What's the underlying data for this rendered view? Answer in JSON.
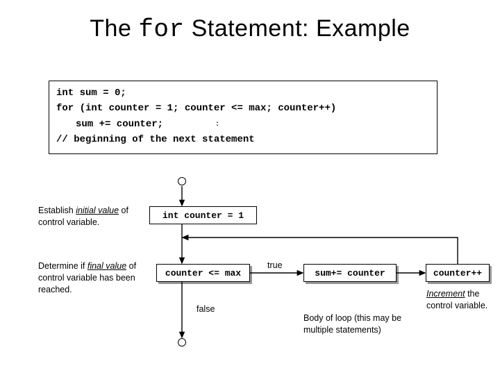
{
  "title": {
    "pre": "The ",
    "kw": "for",
    "post": " Statement: Example"
  },
  "code": {
    "line1": "int sum = 0;",
    "line2": "for (int counter = 1; counter <= max; counter++)",
    "line3": "sum += counter;",
    "line4": "// beginning of the next statement",
    "extra_colon": ":"
  },
  "flow": {
    "init": "int counter = 1",
    "cond": "counter <= max",
    "body": "sum+= counter",
    "incr": "counter++",
    "true_label": "true",
    "false_label": "false"
  },
  "annot": {
    "initial_a": "Establish ",
    "initial_b": "initial value",
    "initial_c": " of control variable.",
    "final_a": "Determine if ",
    "final_b": "final value",
    "final_c": " of control variable has been reached.",
    "body": "Body of loop (this may be multiple statements)",
    "incr_a": "Increment",
    "incr_b": " the control variable."
  }
}
